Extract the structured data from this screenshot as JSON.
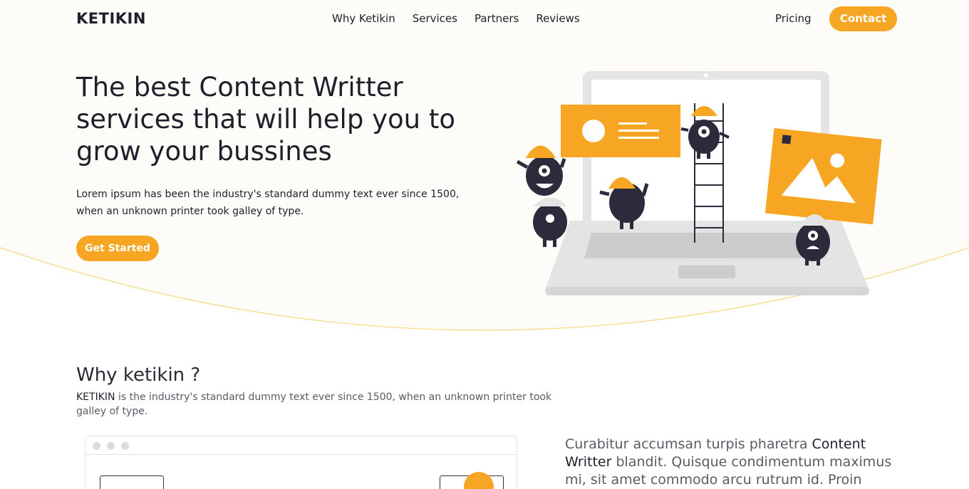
{
  "nav": {
    "logo": "KETIKIN",
    "links": [
      "Why Ketikin",
      "Services",
      "Partners",
      "Reviews"
    ],
    "pricing": "Pricing",
    "contact": "Contact"
  },
  "hero": {
    "title": "The best Content Writter services that will help you to grow your bussines",
    "text": "Lorem ipsum has been the industry's standard dummy text ever since 1500, when an unknown printer took galley of type.",
    "cta": "Get Started"
  },
  "why": {
    "title": "Why ketikin ?",
    "brand": "KETIKIN",
    "text_rest": " is the industry's standard dummy text ever since 1500, when an unknown printer took galley of type."
  },
  "content": {
    "part1": "Curabitur accumsan turpis pharetra ",
    "highlight": "Content Writter",
    "part2": " blandit. Quisque condimentum maximus mi, sit amet commodo arcu rutrum id. Proin"
  },
  "colors": {
    "accent": "#f7a623",
    "dark": "#2c2b3b",
    "hero_bg": "#fdfcf8"
  }
}
